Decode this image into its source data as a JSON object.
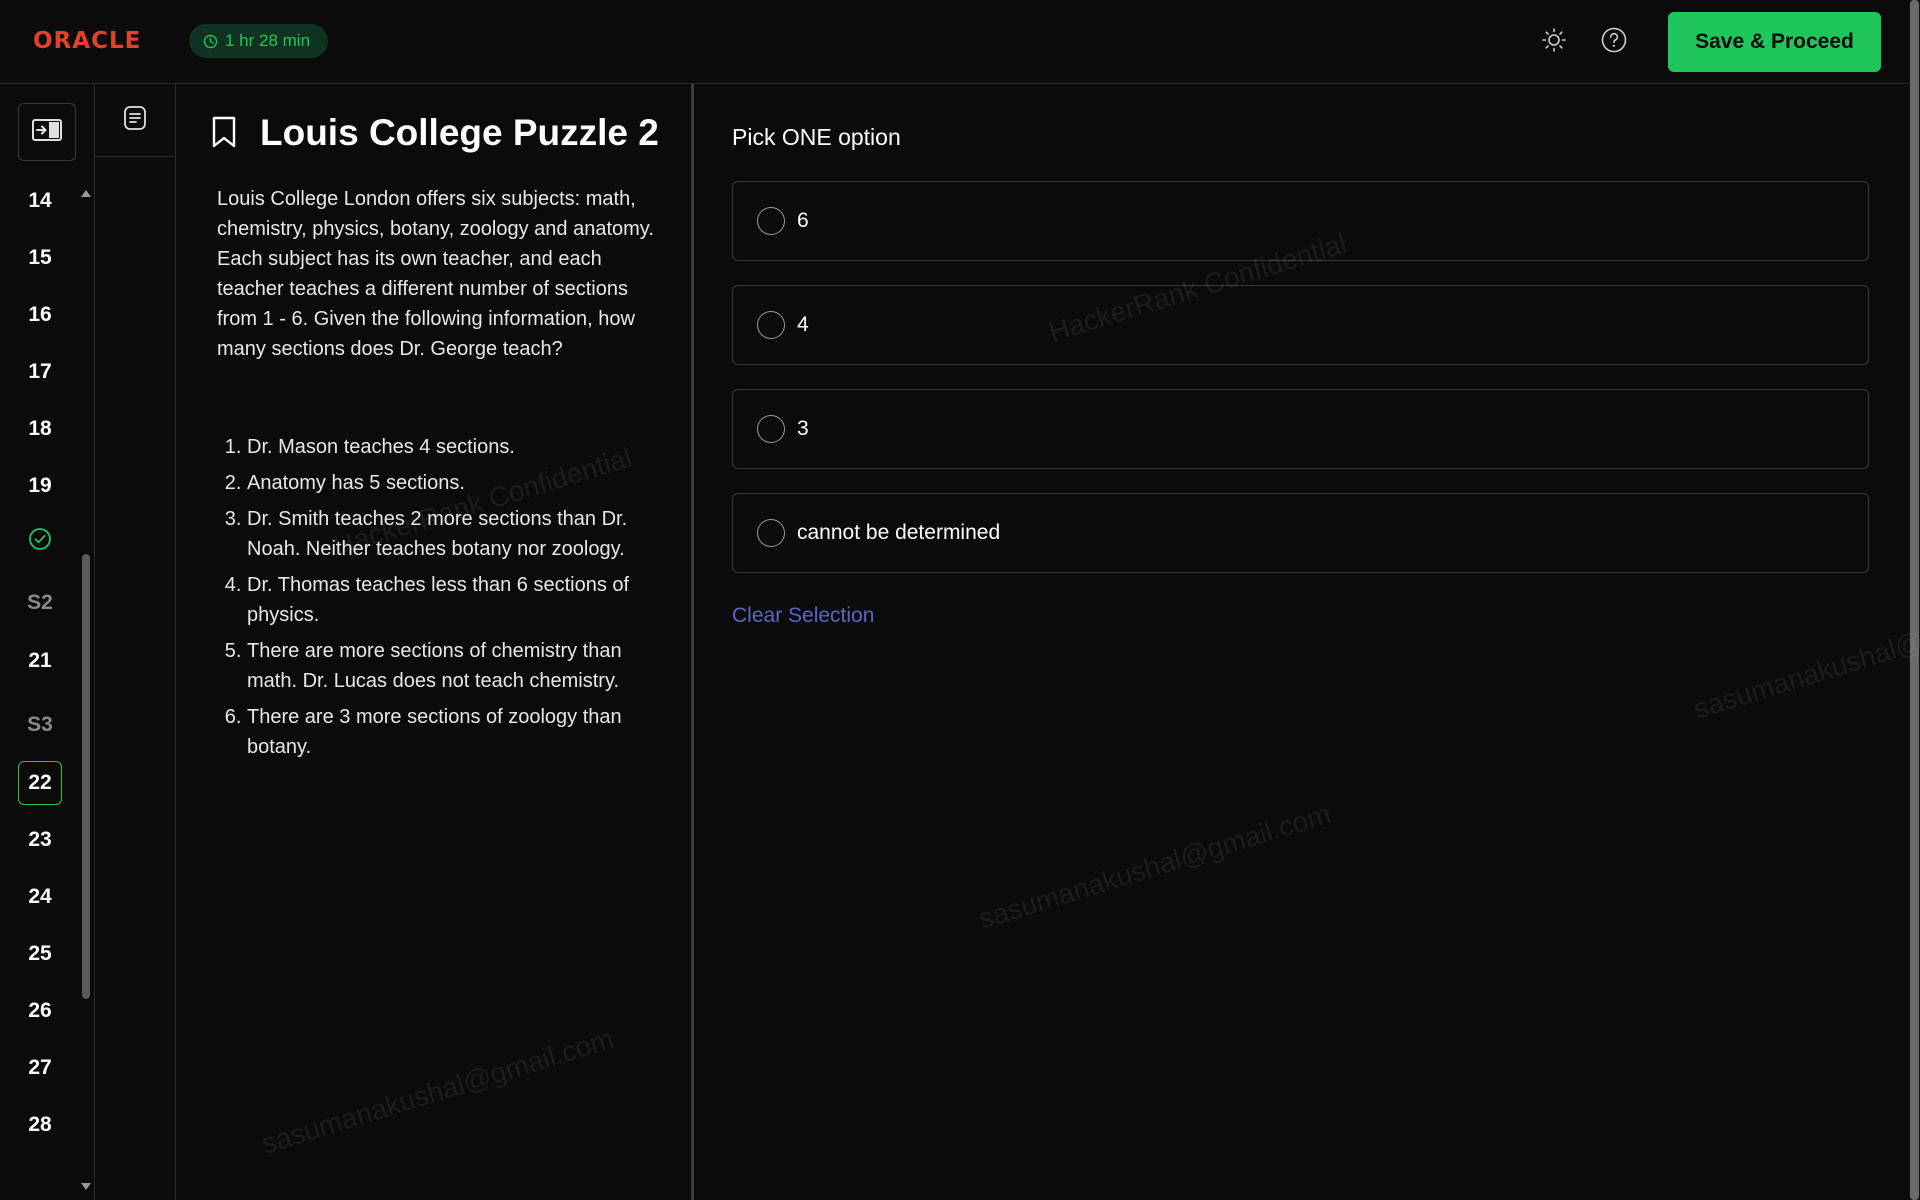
{
  "header": {
    "logo_text": "ORACLE",
    "timer_text": "1 hr 28 min",
    "save_label": "Save & Proceed",
    "icons": [
      "theme-sun-icon",
      "help-icon",
      "timer-clock-icon"
    ]
  },
  "nav": {
    "items": [
      {
        "label": "14",
        "state": "normal"
      },
      {
        "label": "15",
        "state": "normal"
      },
      {
        "label": "16",
        "state": "normal"
      },
      {
        "label": "17",
        "state": "normal"
      },
      {
        "label": "18",
        "state": "normal"
      },
      {
        "label": "19",
        "state": "normal"
      },
      {
        "label": "",
        "state": "answered",
        "icon": "check-circle-icon"
      },
      {
        "label": "S2",
        "state": "section"
      },
      {
        "label": "21",
        "state": "normal"
      },
      {
        "label": "S3",
        "state": "section"
      },
      {
        "label": "22",
        "state": "current"
      },
      {
        "label": "23",
        "state": "normal"
      },
      {
        "label": "24",
        "state": "normal"
      },
      {
        "label": "25",
        "state": "normal"
      },
      {
        "label": "26",
        "state": "normal"
      },
      {
        "label": "27",
        "state": "normal"
      },
      {
        "label": "28",
        "state": "normal"
      }
    ]
  },
  "question": {
    "title": "Louis College Puzzle 2",
    "body": "Louis College London offers six subjects: math, chemistry, physics, botany, zoology and anatomy. Each subject has its own teacher, and each teacher teaches a different number of sections from 1 - 6. Given the following information, how many sections does Dr. George teach?",
    "rules": [
      "Dr. Mason teaches 4 sections.",
      "Anatomy has 5 sections.",
      "Dr. Smith teaches 2 more sections than Dr. Noah. Neither teaches botany nor zoology.",
      "Dr. Thomas teaches less than 6 sections of physics.",
      "There are more sections of chemistry than math. Dr. Lucas does not teach chemistry.",
      "There are 3 more sections of zoology than botany."
    ]
  },
  "answers": {
    "prompt": "Pick ONE option",
    "options": [
      "6",
      "4",
      "3",
      "cannot be determined"
    ],
    "clear_label": "Clear Selection"
  },
  "watermarks": {
    "confidential": "HackerRank Confidential",
    "email": "sasumanakushal@gmail.com"
  },
  "colors": {
    "accent_green": "#1fc65b",
    "brand_red": "#e2412b",
    "link_blue": "#5a66c4",
    "background": "#0b0b0b"
  }
}
